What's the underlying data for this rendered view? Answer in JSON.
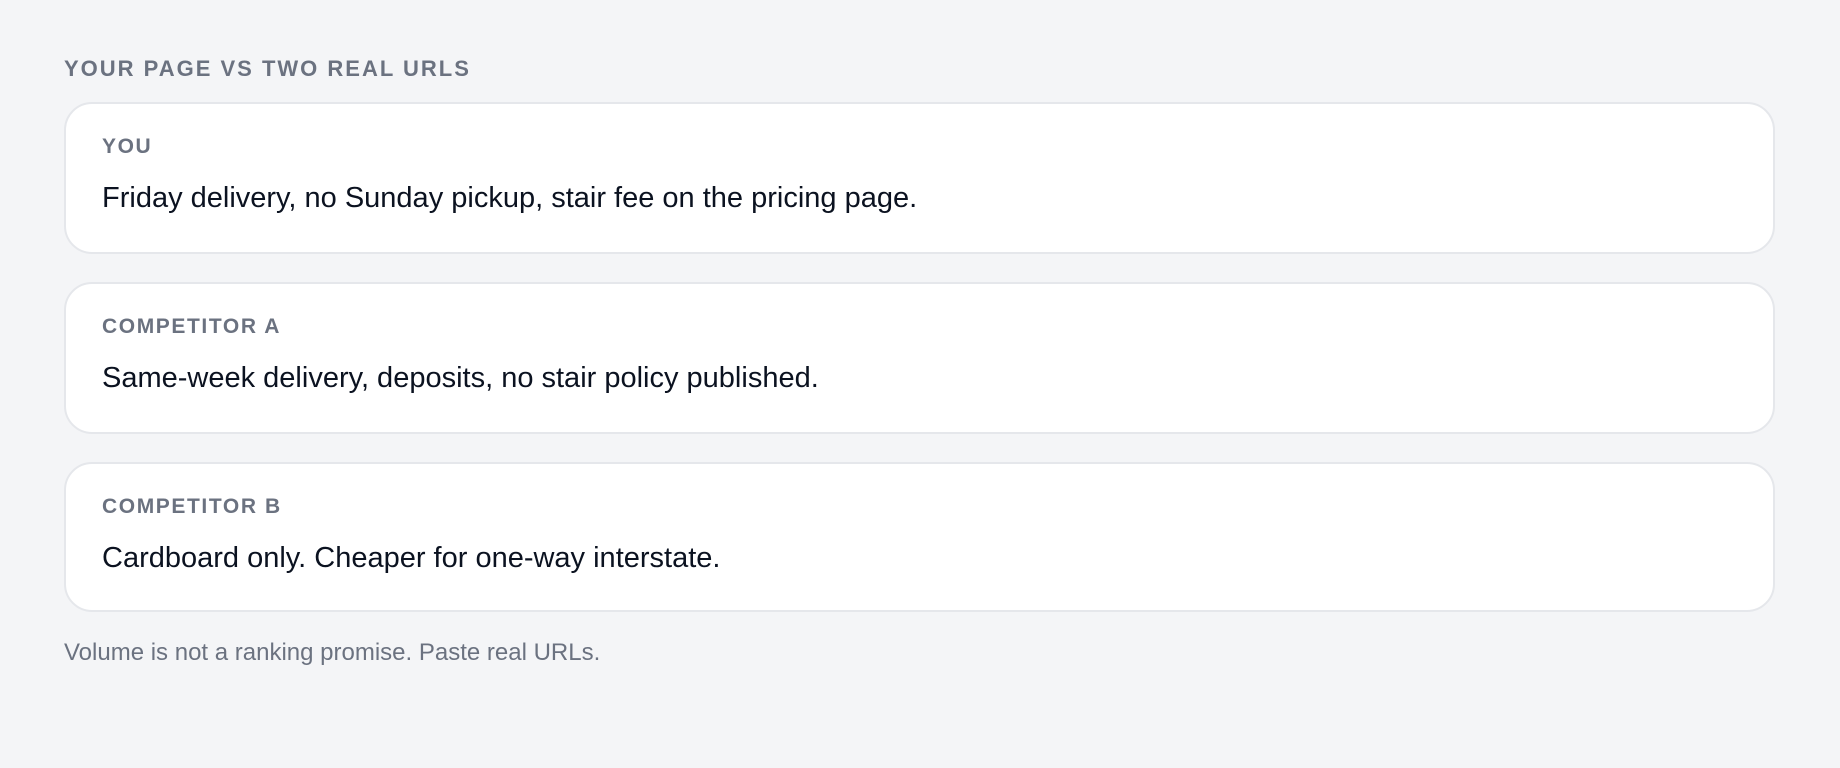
{
  "section": {
    "title": "YOUR PAGE VS TWO REAL URLS"
  },
  "cards": [
    {
      "label": "YOU",
      "text": "Friday delivery, no Sunday pickup, stair fee on the pricing page."
    },
    {
      "label": "COMPETITOR A",
      "text": "Same-week delivery, deposits, no stair policy published."
    },
    {
      "label": "COMPETITOR B",
      "text": "Cardboard only. Cheaper for one-way interstate."
    }
  ],
  "footnote": "Volume is not a ranking promise. Paste real URLs.",
  "colors": {
    "background": "#f4f5f7",
    "card": "#ffffff",
    "border": "#e5e7eb",
    "muted_text": "#6b7280",
    "body_text": "#0b1220"
  }
}
